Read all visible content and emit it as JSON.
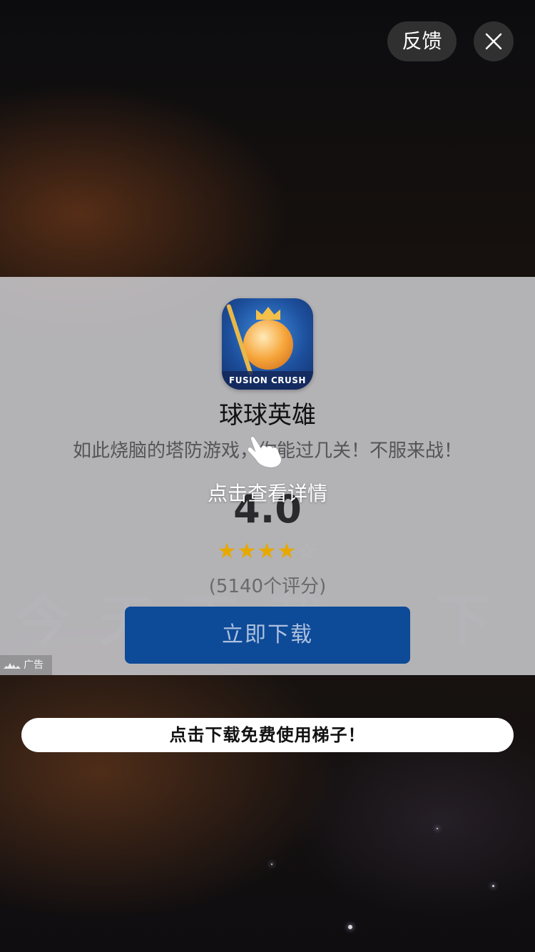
{
  "header": {
    "feedback_label": "反馈",
    "close_icon": "close-icon"
  },
  "ad": {
    "app": {
      "icon_name": "app-icon",
      "icon_banner_text": "FUSION CRUSH",
      "name": "球球英雄",
      "tagline": "如此烧脑的塔防游戏，你能过几关！不服来战！"
    },
    "tap_hint": "点击查看详情",
    "rating": {
      "score": "4.0",
      "stars_filled": 4,
      "stars_total": 5,
      "count_text": "(5140个评分)"
    },
    "download_label": "立即下载",
    "watermark_text": "今天下载一下",
    "badge_label": "广告",
    "colors": {
      "download_button": "#0d4a98",
      "star_filled": "#e6a800",
      "star_empty": "#b9b9bd"
    }
  },
  "banner": {
    "label": "点击下载免费使用梯子！"
  }
}
